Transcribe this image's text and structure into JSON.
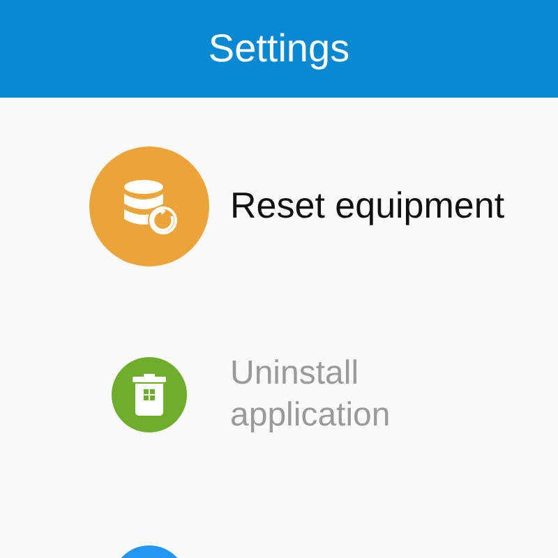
{
  "header": {
    "title": "Settings"
  },
  "items": [
    {
      "kind": "reset",
      "label": "Reset equipment",
      "selected": true,
      "color": "#eba43a"
    },
    {
      "kind": "uninstall",
      "label": "Uninstall application",
      "selected": false,
      "color": "#6fae2d"
    },
    {
      "kind": "partial",
      "selected": false,
      "color": "#2196f3"
    }
  ]
}
